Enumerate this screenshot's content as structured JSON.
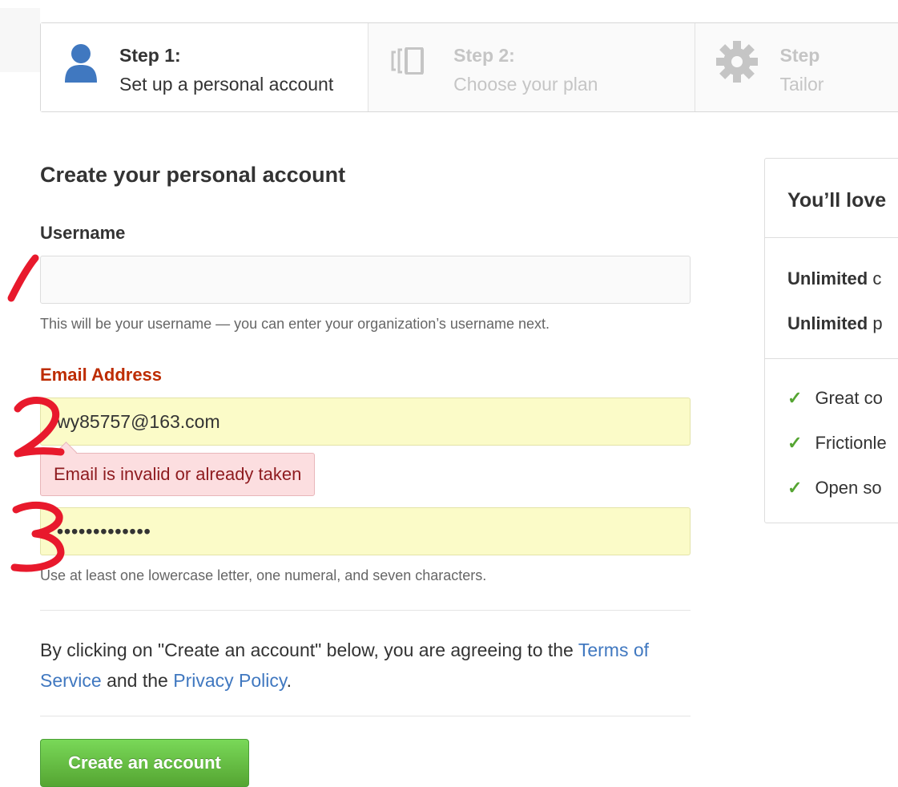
{
  "steps": [
    {
      "title": "Step 1:",
      "subtitle": "Set up a personal account",
      "icon": "person-icon",
      "state": "active"
    },
    {
      "title": "Step 2:",
      "subtitle": "Choose your plan",
      "icon": "plan-icon",
      "state": "inactive"
    },
    {
      "title": "Step",
      "subtitle": "Tailor",
      "icon": "gear-icon",
      "state": "inactive"
    }
  ],
  "form": {
    "heading": "Create your personal account",
    "username_label": "Username",
    "username_value": "",
    "username_note": "This will be your username — you can enter your organization’s username next.",
    "email_label": "Email Address",
    "email_value": "wy85757@163.com",
    "email_error": "Email is invalid or already taken",
    "password_value": "•••••••••••••",
    "password_note": "Use at least one lowercase letter, one numeral, and seven characters.",
    "agree_prefix": "By clicking on \"Create an account\" below, you are agreeing to the ",
    "terms_link": "Terms of Service",
    "agree_mid": " and the ",
    "privacy_link": "Privacy Policy",
    "agree_suffix": ".",
    "create_button": "Create an account"
  },
  "panel": {
    "title": "You’ll love",
    "lines": [
      {
        "bold": "Unlimited",
        "rest": " c"
      },
      {
        "bold": "Unlimited",
        "rest": " p"
      }
    ],
    "checks": [
      "Great co",
      "Frictionle",
      "Open so"
    ]
  },
  "colors": {
    "error_label": "#bd2c00",
    "autofill": "#fbfbc8",
    "link": "#4078c0",
    "button_green": "#55a532",
    "annotation_red": "#e8192c"
  }
}
